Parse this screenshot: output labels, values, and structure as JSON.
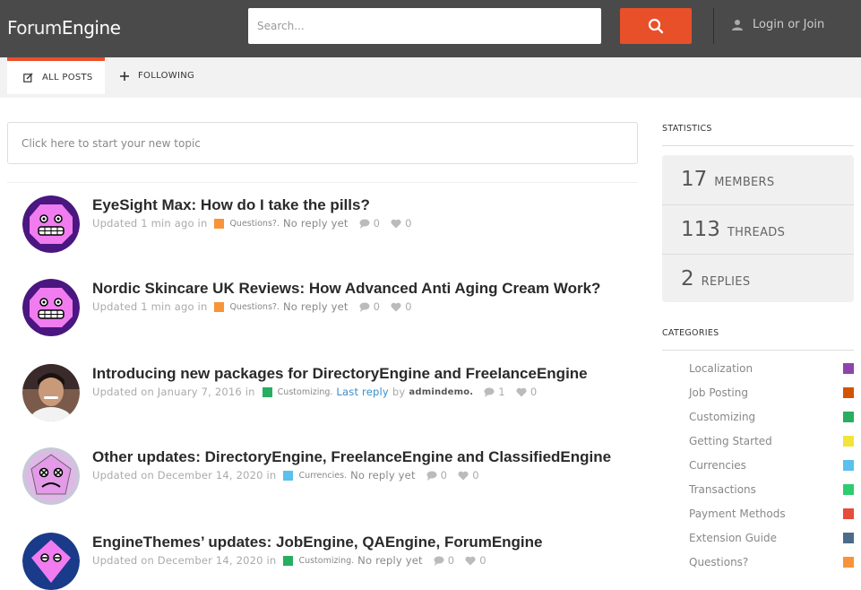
{
  "header": {
    "logo_light": "Forum",
    "logo_bold": "Engine",
    "search_placeholder": "Search...",
    "login_label": "Login or Join",
    "accent": "#e8502a"
  },
  "tabs": [
    {
      "label": "ALL POSTS",
      "icon": "edit-icon",
      "active": true
    },
    {
      "label": "FOLLOWING",
      "icon": "plus-icon",
      "active": false
    }
  ],
  "new_topic_placeholder": "Click here to start your new topic",
  "posts": [
    {
      "title": "EyeSight Max: How do I take the pills?",
      "updated": "Updated  1 min ago  in",
      "category": "Questions?.",
      "category_color": "#f7943a",
      "reply_text": "No reply yet",
      "comments": "0",
      "likes": "0"
    },
    {
      "title": "Nordic Skincare UK Reviews: How Advanced Anti Aging Cream Work?",
      "updated": "Updated  1 min ago  in",
      "category": "Questions?.",
      "category_color": "#f7943a",
      "reply_text": "No reply yet",
      "comments": "0",
      "likes": "0"
    },
    {
      "title": "Introducing new packages for DirectoryEngine and FreelanceEngine",
      "updated": "Updated  on  January 7, 2016  in",
      "category": "Customizing.",
      "category_color": "#27ae60",
      "reply_text": "Last reply",
      "reply_by": "by",
      "reply_user": "admindemo.",
      "comments": "1",
      "likes": "0"
    },
    {
      "title": "Other updates: DirectoryEngine, FreelanceEngine and ClassifiedEngine",
      "updated": "Updated  on  December 14, 2020  in",
      "category": "Currencies.",
      "category_color": "#5bc0eb",
      "reply_text": "No reply yet",
      "comments": "0",
      "likes": "0"
    },
    {
      "title": "EngineThemes’ updates: JobEngine, QAEngine, ForumEngine",
      "updated": "Updated  on  December 14, 2020  in",
      "category": "Customizing.",
      "category_color": "#27ae60",
      "reply_text": "No reply yet",
      "comments": "0",
      "likes": "0"
    }
  ],
  "sidebar": {
    "statistics_title": "STATISTICS",
    "stats": [
      {
        "num": "17",
        "label": "MEMBERS"
      },
      {
        "num": "113",
        "label": "THREADS"
      },
      {
        "num": "2",
        "label": "REPLIES"
      }
    ],
    "categories_title": "CATEGORIES",
    "categories": [
      {
        "name": "Localization",
        "color": "#8e44ad"
      },
      {
        "name": "Job Posting",
        "color": "#d35400"
      },
      {
        "name": "Customizing",
        "color": "#27ae60"
      },
      {
        "name": "Getting Started",
        "color": "#f1e43a"
      },
      {
        "name": "Currencies",
        "color": "#5bc0eb"
      },
      {
        "name": "Transactions",
        "color": "#2ecc71"
      },
      {
        "name": "Payment Methods",
        "color": "#e74c3c"
      },
      {
        "name": "Extension Guide",
        "color": "#4a6b8a"
      },
      {
        "name": "Questions?",
        "color": "#f7943a"
      }
    ]
  }
}
